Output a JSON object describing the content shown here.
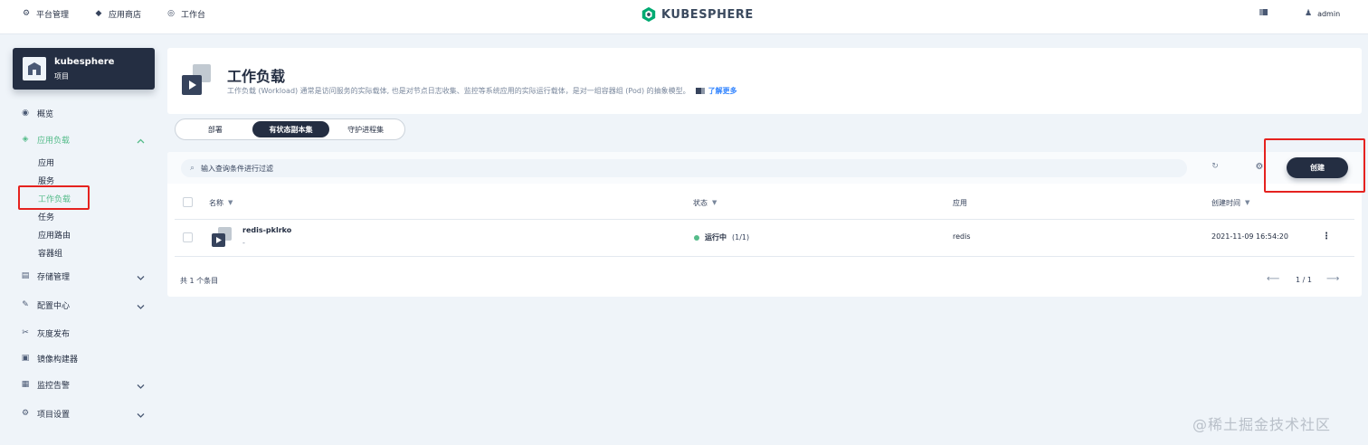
{
  "topbar": {
    "nav": [
      {
        "label": "平台管理",
        "icon": "platform-icon"
      },
      {
        "label": "应用商店",
        "icon": "app-store-icon"
      },
      {
        "label": "工作台",
        "icon": "workbench-icon"
      }
    ],
    "brand": "KUBESPHERE",
    "user": "admin"
  },
  "sidebar": {
    "project_name": "kubesphere",
    "project_type": "项目",
    "items": [
      {
        "label": "概览",
        "icon": "overview-icon"
      },
      {
        "label": "应用负载",
        "icon": "app-workload-icon",
        "expanded": true
      },
      {
        "label": "存储管理",
        "icon": "storage-icon"
      },
      {
        "label": "配置中心",
        "icon": "config-icon"
      },
      {
        "label": "灰度发布",
        "icon": "grayscale-icon"
      },
      {
        "label": "镜像构建器",
        "icon": "image-builder-icon"
      },
      {
        "label": "监控告警",
        "icon": "monitoring-icon"
      },
      {
        "label": "项目设置",
        "icon": "settings-icon"
      }
    ],
    "sub_items": [
      "应用",
      "服务",
      "工作负载",
      "任务",
      "应用路由",
      "容器组"
    ],
    "active_sub": "工作负载"
  },
  "header": {
    "title": "工作负载",
    "description": "工作负载 (Workload) 通常是访问服务的实际载体, 也是对节点日志收集、监控等系统应用的实际运行载体，是对一组容器组 (Pod) 的抽象模型。",
    "learn_more": "了解更多"
  },
  "tabs": [
    "部署",
    "有状态副本集",
    "守护进程集"
  ],
  "active_tab": "有状态副本集",
  "toolbar": {
    "search_placeholder": "输入查询条件进行过滤",
    "create_label": "创建"
  },
  "table": {
    "columns": [
      "名称",
      "状态",
      "应用",
      "创建时间"
    ],
    "rows": [
      {
        "name": "redis-pklrko",
        "sub": "-",
        "status": "运行中",
        "status_count": "(1/1)",
        "app": "redis",
        "created": "2021-11-09 16:54:20"
      }
    ],
    "total": "共 1 个条目",
    "page": "1 / 1"
  },
  "watermark": "@稀土掘金技术社区",
  "colors": {
    "dark": "#242e42",
    "accent_green": "#55bc8a",
    "highlight_red": "#e5221f",
    "background": "#eff4f9"
  }
}
